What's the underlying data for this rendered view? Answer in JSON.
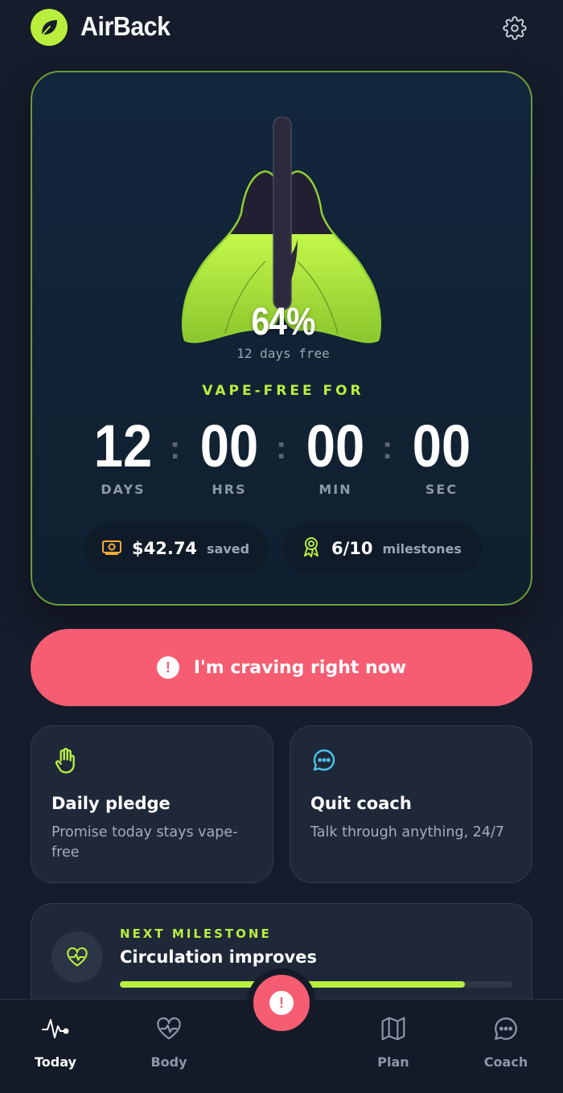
{
  "app": {
    "title": "AirBack",
    "logo_icon": "leaf-icon",
    "settings_icon": "gear-icon"
  },
  "colors": {
    "accent": "#b8ee3f",
    "alert": "#f65d72",
    "background": "#151c2b",
    "card": "#1e2839"
  },
  "hero": {
    "lung_fill_percent": 64,
    "percent_text": "64%",
    "days_free_text": "12 days free",
    "label": "VAPE-FREE FOR",
    "timer": [
      {
        "value": "12",
        "unit": "DAYS"
      },
      {
        "value": "00",
        "unit": "HRS"
      },
      {
        "value": "00",
        "unit": "MIN"
      },
      {
        "value": "00",
        "unit": "SEC"
      }
    ],
    "separator": ":",
    "saved": {
      "value": "$42.74",
      "label": "saved",
      "icon": "cash-icon"
    },
    "milestones": {
      "value": "6/10",
      "label": "milestones",
      "icon": "award-icon"
    }
  },
  "craving_button": {
    "label": "I'm craving right now",
    "icon": "alert-icon"
  },
  "cards": [
    {
      "title": "Daily pledge",
      "subtitle": "Promise today stays vape-free",
      "icon": "hand-icon"
    },
    {
      "title": "Quit coach",
      "subtitle": "Talk through anything, 24/7",
      "icon": "chat-icon"
    }
  ],
  "next_milestone": {
    "label": "NEXT MILESTONE",
    "title": "Circulation improves",
    "progress": 0.88,
    "icon": "heart-pulse-icon"
  },
  "bottom_nav": {
    "items": [
      {
        "label": "Today",
        "icon": "activity-icon",
        "active": true
      },
      {
        "label": "Body",
        "icon": "heart-pulse-icon",
        "active": false
      },
      {
        "label": "Plan",
        "icon": "map-icon",
        "active": false
      },
      {
        "label": "Coach",
        "icon": "chat-icon",
        "active": false
      }
    ],
    "fab_icon": "alert-icon"
  }
}
